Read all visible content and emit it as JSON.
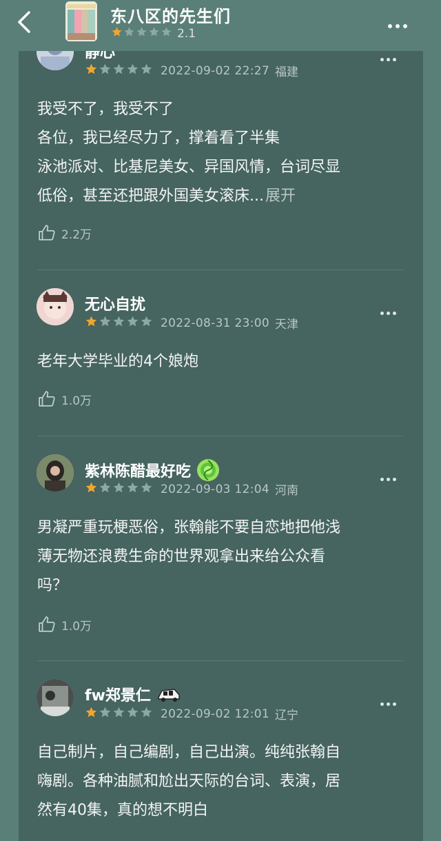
{
  "header": {
    "title": "东八区的先生们",
    "rating_score": "2.1",
    "stars_filled": 1,
    "stars_total": 5
  },
  "colors": {
    "star_filled": "#f2a62b",
    "star_empty": "#8ea9a3",
    "background": "#5a7f78",
    "card": "#466460"
  },
  "reviews": [
    {
      "username": "静心",
      "stars_filled": 1,
      "time": "2022-09-02 22:27",
      "location": "福建",
      "lines": [
        "我受不了，我受不了",
        "各位，我已经尽力了，撑着看了半集",
        "泳池派对、比基尼美女、异国风情，台词尽显",
        "低俗，甚至还把跟外国美女滚床..."
      ],
      "expand_label": "展开",
      "likes": "2.2万"
    },
    {
      "username": "无心自扰",
      "stars_filled": 1,
      "time": "2022-08-31 23:00",
      "location": "天津",
      "lines": [
        "老年大学毕业的4个娘炮"
      ],
      "likes": "1.0万"
    },
    {
      "username": "紫林陈醋最好吃",
      "badge_icon": "green-portal-badge-icon",
      "stars_filled": 1,
      "time": "2022-09-03 12:04",
      "location": "河南",
      "lines": [
        "男凝严重玩梗恶俗，张翰能不要自恋地把他浅",
        "薄无物还浪费生命的世界观拿出来给公众看",
        "吗？"
      ],
      "likes": "1.0万"
    },
    {
      "username": "fw郑景仁",
      "badge_icon": "car-badge-icon",
      "stars_filled": 1,
      "time": "2022-09-02 12:01",
      "location": "辽宁",
      "lines": [
        "自己制片，自己编剧，自己出演。纯纯张翰自",
        "嗨剧。各种油腻和尬出天际的台词、表演，居",
        "然有40集，真的想不明白"
      ]
    }
  ]
}
